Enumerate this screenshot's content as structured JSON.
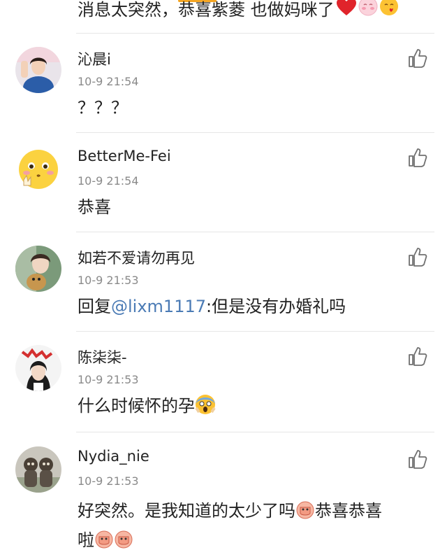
{
  "top_comment": {
    "text": "消息太突然，恭喜紫菱 也做妈咪了"
  },
  "comments": [
    {
      "username": "沁晨i",
      "time": "10-9 21:54",
      "text": "？？？"
    },
    {
      "username": "BetterMe-Fei",
      "time": "10-9 21:54",
      "text": "恭喜"
    },
    {
      "username": "如若不爱请勿再见",
      "time": "10-9 21:53",
      "reply_prefix": "回复",
      "mention": "@lixm1117",
      "text": ":但是没有办婚礼吗"
    },
    {
      "username": "陈柒柒-",
      "time": "10-9 21:53",
      "text": "什么时候怀的孕"
    },
    {
      "username": "Nydia_nie",
      "time": "10-9 21:53",
      "text_line1": "好突然。是我知道的太少了吗",
      "text_mid": "恭喜恭喜",
      "text_line2": "啦"
    }
  ],
  "colors": {
    "mention": "#4b7bb5",
    "divider": "#e6e6e6",
    "time": "#8a8a8a",
    "accent": "#f5a623"
  }
}
